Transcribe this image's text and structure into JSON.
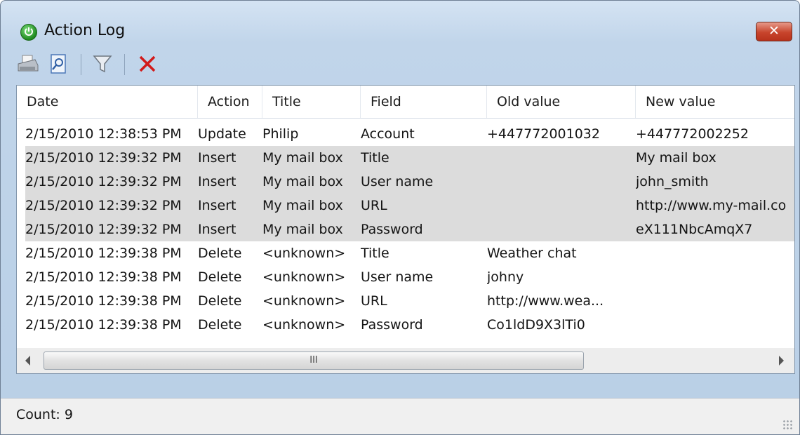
{
  "window": {
    "title": "Action Log",
    "close_label": "✕"
  },
  "toolbar": {
    "buttons": [
      {
        "name": "print",
        "icon": "printer-icon"
      },
      {
        "name": "preview",
        "icon": "print-preview-icon"
      },
      {
        "name": "filter",
        "icon": "filter-icon"
      },
      {
        "name": "delete",
        "icon": "delete-x-icon"
      }
    ]
  },
  "table": {
    "columns": [
      "Date",
      "Action",
      "Title",
      "Field",
      "Old value",
      "New value"
    ],
    "rows": [
      {
        "date": "2/15/2010 12:38:53 PM",
        "action": "Update",
        "title": "Philip",
        "field": "Account",
        "old": "+447772001032",
        "new": "+447772002252",
        "selected": false
      },
      {
        "date": "2/15/2010 12:39:32 PM",
        "action": "Insert",
        "title": "My mail box",
        "field": "Title",
        "old": "",
        "new": "My mail box",
        "selected": true
      },
      {
        "date": "2/15/2010 12:39:32 PM",
        "action": "Insert",
        "title": "My mail box",
        "field": "User name",
        "old": "",
        "new": "john_smith",
        "selected": true
      },
      {
        "date": "2/15/2010 12:39:32 PM",
        "action": "Insert",
        "title": "My mail box",
        "field": "URL",
        "old": "",
        "new": "http://www.my-mail.co",
        "selected": true
      },
      {
        "date": "2/15/2010 12:39:32 PM",
        "action": "Insert",
        "title": "My mail box",
        "field": "Password",
        "old": "",
        "new": "eX111NbcAmqX7",
        "selected": true
      },
      {
        "date": "2/15/2010 12:39:38 PM",
        "action": "Delete",
        "title": "<unknown>",
        "field": "Title",
        "old": "Weather chat",
        "new": "",
        "selected": false
      },
      {
        "date": "2/15/2010 12:39:38 PM",
        "action": "Delete",
        "title": "<unknown>",
        "field": "User name",
        "old": "johny",
        "new": "",
        "selected": false
      },
      {
        "date": "2/15/2010 12:39:38 PM",
        "action": "Delete",
        "title": "<unknown>",
        "field": "URL",
        "old": "http://www.wea...",
        "new": "",
        "selected": false
      },
      {
        "date": "2/15/2010 12:39:38 PM",
        "action": "Delete",
        "title": "<unknown>",
        "field": "Password",
        "old": "Co1ldD9X3lTi0",
        "new": "",
        "selected": false
      }
    ]
  },
  "scrollbar": {
    "thumb_label": "III"
  },
  "status": {
    "count_text": "Count: 9"
  },
  "colors": {
    "selection": "#dcdcdc",
    "close_button": "#c8442c",
    "delete_icon": "#d21a1a"
  }
}
